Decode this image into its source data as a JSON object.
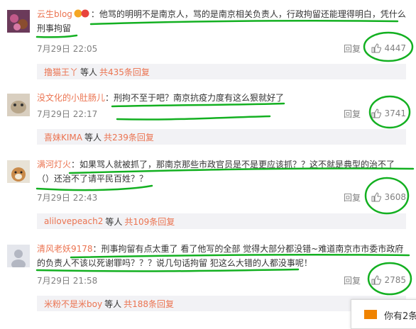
{
  "comments": [
    {
      "user": "云生blog",
      "text": "：他骂的明明不是南京人，骂的是南京相关负责人，行政拘留还能理得明白，凭什么刑事拘留",
      "time": "7月29日 22:05",
      "reply_label": "回复",
      "likes": "4447",
      "sub_user": "撸猫王丫",
      "sub_mid": "等人",
      "sub_count": "共435条回复"
    },
    {
      "user": "没文化的小肚肠儿",
      "text": "：刑拘不至于吧？南京抗疫力度有这么狠就好了",
      "time": "7月29日 22:17",
      "reply_label": "回复",
      "likes": "3741",
      "sub_user": "喜妹KIMA",
      "sub_mid": "等人",
      "sub_count": "共239条回复"
    },
    {
      "user": "满河灯火",
      "text": "：如果骂人就被抓了，那南京那些市政官员是不是更应该抓？？这不就是典型的治不了（）还治不了请平民百姓？？",
      "time": "7月29日 22:43",
      "reply_label": "回复",
      "likes": "3608",
      "sub_user": "alilovepeach2",
      "sub_mid": "等人",
      "sub_count": "共109条回复"
    },
    {
      "user": "清风老妖9178",
      "text": "：刑事拘留有点太重了 看了他写的全部 觉得大部分都没错~难道南京市市委市政府的负责人不该以死谢罪吗？？？说几句话拘留 犯这么大错的人都没事呢！",
      "time": "7月29日 21:58",
      "reply_label": "回复",
      "likes": "2785",
      "sub_user": "米粉不是米boy",
      "sub_mid": "等人",
      "sub_count": "共188条回复"
    }
  ],
  "popup": {
    "text": "你有2条"
  },
  "colors": {
    "username": "#eb7350",
    "meta": "#808080",
    "subbox": "#f2f2f5",
    "annotation": "#13b021"
  }
}
